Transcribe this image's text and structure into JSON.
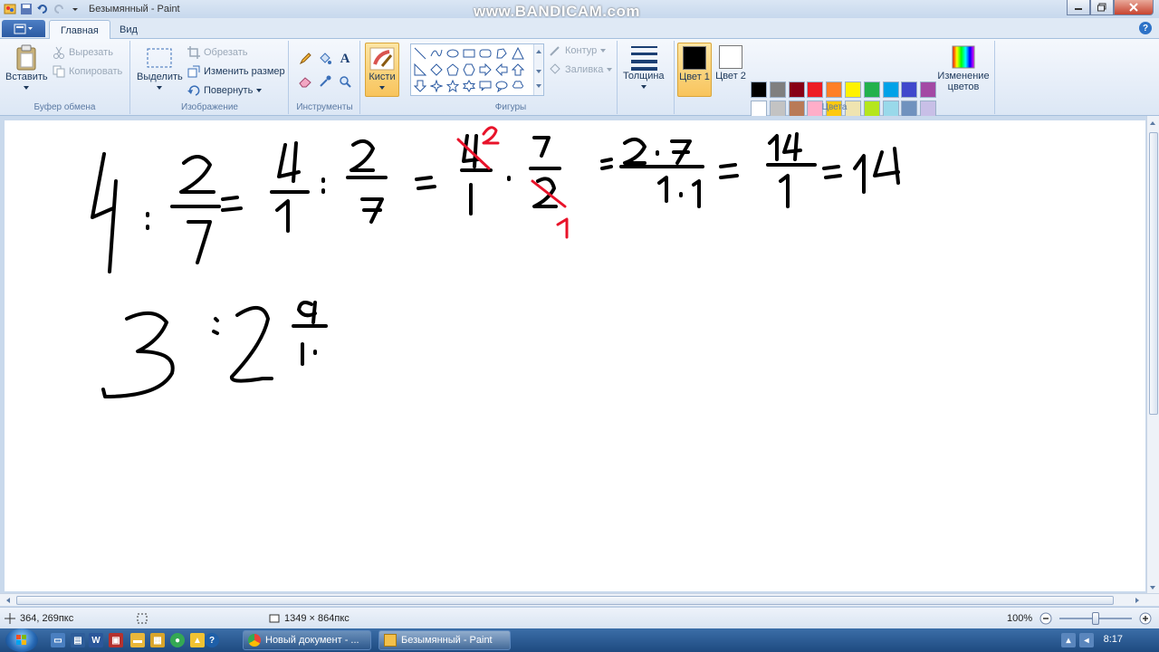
{
  "window": {
    "title": "Безымянный - Paint",
    "watermark": "www.BANDICAM.com"
  },
  "tabs": [
    {
      "label": "Главная"
    },
    {
      "label": "Вид"
    }
  ],
  "ribbon": {
    "clipboard": {
      "paste": "Вставить",
      "cut": "Вырезать",
      "copy": "Копировать",
      "group": "Буфер обмена"
    },
    "image": {
      "select": "Выделить",
      "crop": "Обрезать",
      "resize": "Изменить размер",
      "rotate": "Повернуть",
      "group": "Изображение"
    },
    "tools": {
      "group": "Инструменты"
    },
    "brushes": {
      "label": "Кисти"
    },
    "shapes": {
      "outline": "Контур",
      "fill": "Заливка",
      "group": "Фигуры"
    },
    "size": {
      "label": "Толщина"
    },
    "colors": {
      "color1": "Цвет 1",
      "color2": "Цвет 2",
      "edit": "Изменение цветов",
      "group": "Цвета",
      "color1_value": "#000000",
      "color2_value": "#ffffff",
      "palette_row1": [
        "#000000",
        "#7f7f7f",
        "#880015",
        "#ed1c24",
        "#ff7f27",
        "#fff200",
        "#22b14c",
        "#00a2e8",
        "#3f48cc",
        "#a349a4"
      ],
      "palette_row2": [
        "#ffffff",
        "#c3c3c3",
        "#b97a57",
        "#ffaec9",
        "#ffc90e",
        "#efe4b0",
        "#b5e61d",
        "#99d9ea",
        "#7092be",
        "#c8bfe7"
      ]
    }
  },
  "canvas": {
    "ink_color": "#000000",
    "accent_color": "#e8132a"
  },
  "status": {
    "cursor_pos": "364, 269пкс",
    "image_size": "1349 × 864пкс",
    "zoom": "100%"
  },
  "taskbar": {
    "tasks": [
      {
        "label": "Новый документ - ..."
      },
      {
        "label": "Безымянный - Paint"
      }
    ],
    "clock": "8:17"
  }
}
